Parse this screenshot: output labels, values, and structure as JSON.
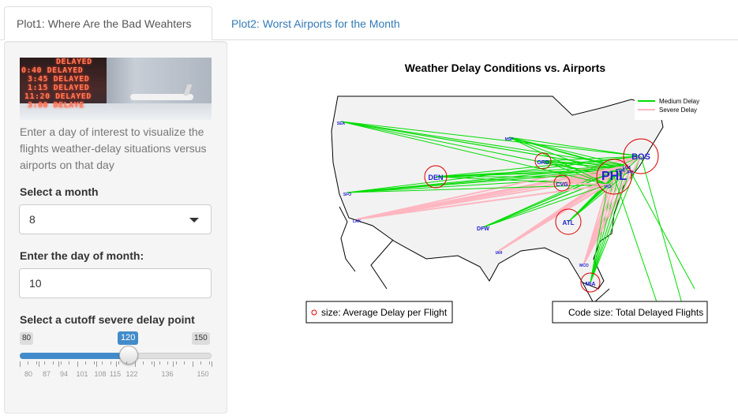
{
  "tabs": [
    {
      "label": "Plot1: Where Are the Bad Weahters",
      "active": true
    },
    {
      "label": "Plot2: Worst Airports for the Month",
      "active": false
    }
  ],
  "banner": {
    "lines": [
      "DELAYED",
      "0:40  DELAYED",
      "3:45 DELAYED",
      "1:15 DELAYED",
      "11:20 DELAYED",
      "3:00 DELAYE"
    ]
  },
  "sidebar": {
    "intro": "Enter a day of interest to visualize the flights weather-delay situations versus airports on that day",
    "month_label": "Select a month",
    "month_value": "8",
    "day_label": "Enter the day of month:",
    "day_value": "10",
    "cutoff_label": "Select a cutoff severe delay point",
    "slider": {
      "min": "80",
      "max": "150",
      "value": "120",
      "tick_labels": [
        "80",
        "87",
        "94",
        "101",
        "108",
        "115",
        "122",
        "136",
        "150"
      ]
    }
  },
  "plot": {
    "title": "Weather Delay Conditions vs. Airports",
    "legend": {
      "medium": "Medium Delay",
      "severe": "Severe Delay"
    },
    "left_note": "size: Average Delay per Flight",
    "right_note": "Code size: Total Delayed Flights",
    "airport_labels": [
      "DEN",
      "PHL",
      "BOS",
      "ORD",
      "CVG",
      "ATL",
      "DFW",
      "MIA",
      "MSP",
      "EWR",
      "LGA",
      "JFK",
      "IAD",
      "LAX",
      "SFO",
      "SEA",
      "IAH",
      "MCO"
    ],
    "colors": {
      "medium": "#00dd00",
      "severe": "#ffb6c1",
      "airport_circle": "#e00000",
      "airport_code": "#2020d0"
    }
  }
}
